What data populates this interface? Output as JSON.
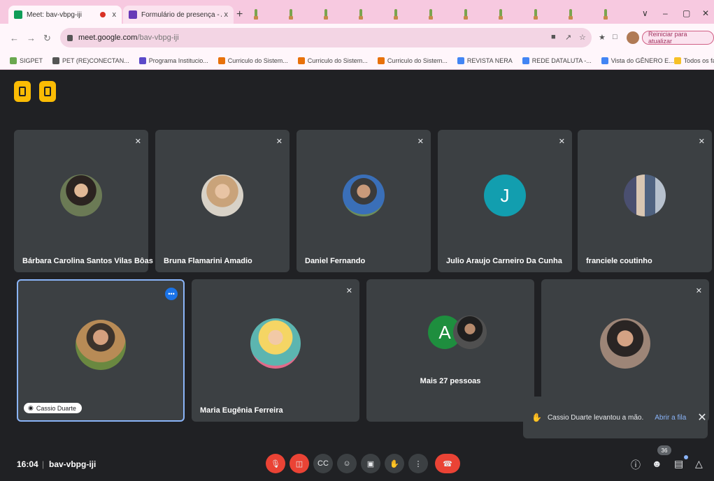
{
  "browser": {
    "tabs": [
      {
        "title": "Meet: bav-vbpg-iji",
        "close": "x"
      },
      {
        "title": "Formulário de presença - APRE",
        "close": "x"
      }
    ],
    "newtab": "+",
    "window_controls": [
      "∨",
      "–",
      "▢",
      "✕"
    ],
    "url_host": "meet.google.com",
    "url_path": "/bav-vbpg-iji",
    "restart_label": "Reiniciar para atualizar"
  },
  "bookmarks": [
    {
      "label": "SIGPET",
      "color": "#6aa84f"
    },
    {
      "label": "PET (RE)CONECTAN...",
      "color": "#555555"
    },
    {
      "label": "Programa Institucio...",
      "color": "#5b49c9"
    },
    {
      "label": "Curriculo do Sistem...",
      "color": "#e8710a"
    },
    {
      "label": "Curriculo do Sistem...",
      "color": "#e8710a"
    },
    {
      "label": "Curriculo do Sistem...",
      "color": "#e8710a"
    },
    {
      "label": "REVISTA NERA",
      "color": "#4285f4"
    },
    {
      "label": "REDE DATALUTA -...",
      "color": "#4285f4"
    },
    {
      "label": "Vista do GÊNERO E...",
      "color": "#4285f4"
    }
  ],
  "bookmarks_other": "Todos os favoritos",
  "participants_row1": [
    {
      "name": "Bárbara Carolina Santos Vilas Bôas",
      "style": "photo"
    },
    {
      "name": "Bruna Flamarini Amadio",
      "style": "photo2"
    },
    {
      "name": "Daniel Fernando",
      "style": "photo3"
    },
    {
      "name": "Julio Araujo Carneiro Da Cunha",
      "style": "letter",
      "letter": "J",
      "color": "#129eaf"
    },
    {
      "name": "franciele coutinho",
      "style": "photo4"
    }
  ],
  "participants_row2": [
    {
      "name": "Cassio Duarte",
      "style": "photo5",
      "selected": true
    },
    {
      "name": "Maria Eugênia Ferreira",
      "style": "photo6"
    },
    {
      "name": "Mais 27 pessoas",
      "style": "group",
      "letter": "A",
      "color": "#1e8e3e"
    },
    {
      "name": "",
      "style": "photo7"
    }
  ],
  "more_options": "•••",
  "toast": {
    "message": "Cassio Duarte levantou a mão.",
    "action": "Abrir a fila",
    "close": "✕"
  },
  "bottom": {
    "time": "16:04",
    "separator": "|",
    "meeting_code": "bav-vbpg-iji",
    "participant_count": "36"
  },
  "colors": {
    "background": "#202124",
    "tile": "#3c4043",
    "danger": "#ea4335",
    "accent": "#8ab4f8",
    "warning": "#fbbc04"
  }
}
